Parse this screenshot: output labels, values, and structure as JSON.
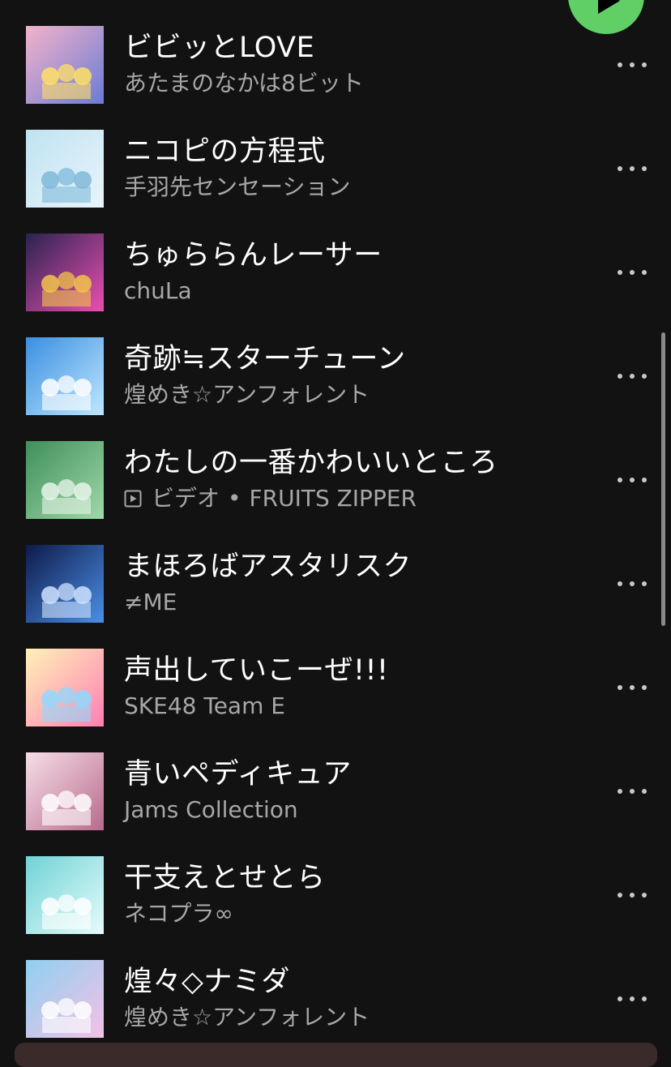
{
  "tracks": [
    {
      "title": "ビビッとLOVE",
      "artist": "あたまのなかは8ビット",
      "is_video": false,
      "art_colors": [
        "#f3b3c9",
        "#6b7bd6",
        "#ffe066"
      ]
    },
    {
      "title": "ニコピの方程式",
      "artist": "手羽先センセーション",
      "is_video": false,
      "art_colors": [
        "#bfe3f2",
        "#e9f4fa",
        "#7fb9d9"
      ]
    },
    {
      "title": "ちゅららんレーサー",
      "artist": "chuLa",
      "is_video": false,
      "art_colors": [
        "#2a2350",
        "#e94fb0",
        "#f3c34a"
      ]
    },
    {
      "title": "奇跡≒スターチューン",
      "artist": "煌めき☆アンフォレント",
      "is_video": false,
      "art_colors": [
        "#3a8fe0",
        "#bfe7ff",
        "#ffffff"
      ]
    },
    {
      "title": "わたしの一番かわいいところ",
      "type_label": "ビデオ",
      "artist": "FRUITS ZIPPER",
      "is_video": true,
      "art_colors": [
        "#3f8f5a",
        "#9fd9a8",
        "#e8f4ea"
      ]
    },
    {
      "title": "まほろばアスタリスク",
      "artist": "≠ME",
      "is_video": false,
      "art_colors": [
        "#0e1a4a",
        "#4b8fe6",
        "#cfe2ff"
      ]
    },
    {
      "title": "声出していこーぜ!!!",
      "artist": "SKE48 Team E",
      "is_video": false,
      "art_colors": [
        "#fff2b8",
        "#ff7fb3",
        "#8fd8ff"
      ]
    },
    {
      "title": "青いペディキュア",
      "artist": "Jams Collection",
      "is_video": false,
      "art_colors": [
        "#f6dfe8",
        "#b86a8c",
        "#ffffff"
      ]
    },
    {
      "title": "干支えとせとら",
      "artist": "ネコプラ∞",
      "is_video": false,
      "art_colors": [
        "#6fd3d6",
        "#e6fbfb",
        "#ffffff"
      ]
    },
    {
      "title": "煌々◇ナミダ",
      "artist": "煌めき☆アンフォレント",
      "is_video": false,
      "art_colors": [
        "#8fd0f0",
        "#f3c1e6",
        "#ffffff"
      ]
    }
  ],
  "icons": {
    "play": "play-icon",
    "more": "more-options-icon",
    "video": "video-icon"
  },
  "colors": {
    "background": "#121212",
    "accent": "#5fcf66",
    "primary_text": "#ffffff",
    "secondary_text": "#a7a7a7"
  }
}
